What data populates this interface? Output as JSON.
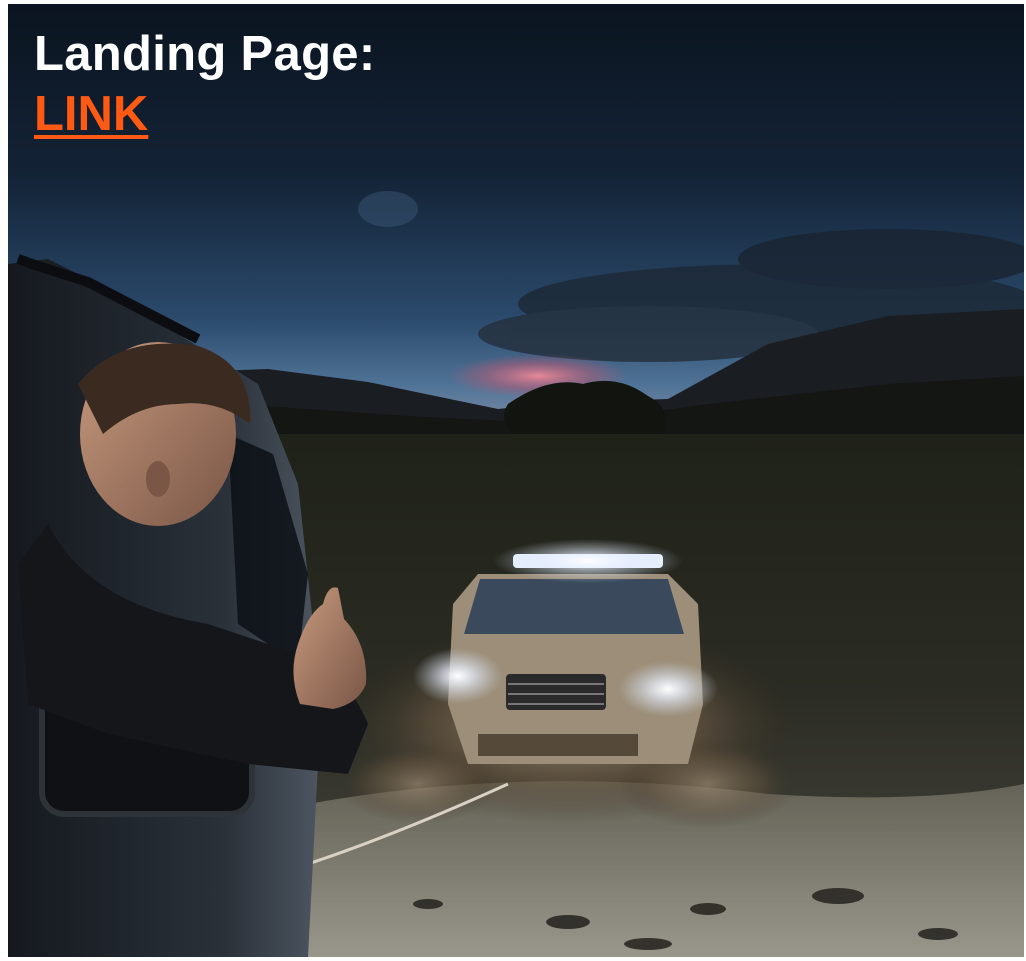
{
  "header": {
    "title": "Landing Page:",
    "link_label": "LINK"
  },
  "colors": {
    "title": "#ffffff",
    "link": "#ff5a14",
    "sky_top": "#0c1724",
    "sky_horizon": "#3a5f86",
    "sunset_glow": "#e07b8c",
    "headlight": "#ffffff"
  },
  "image": {
    "scene": "night-offroad-scene",
    "subjects": [
      "man-leaning-out-of-car-window",
      "pickup-truck-with-light-bar",
      "muddy-water-splash",
      "mountains",
      "tow-rope"
    ]
  }
}
